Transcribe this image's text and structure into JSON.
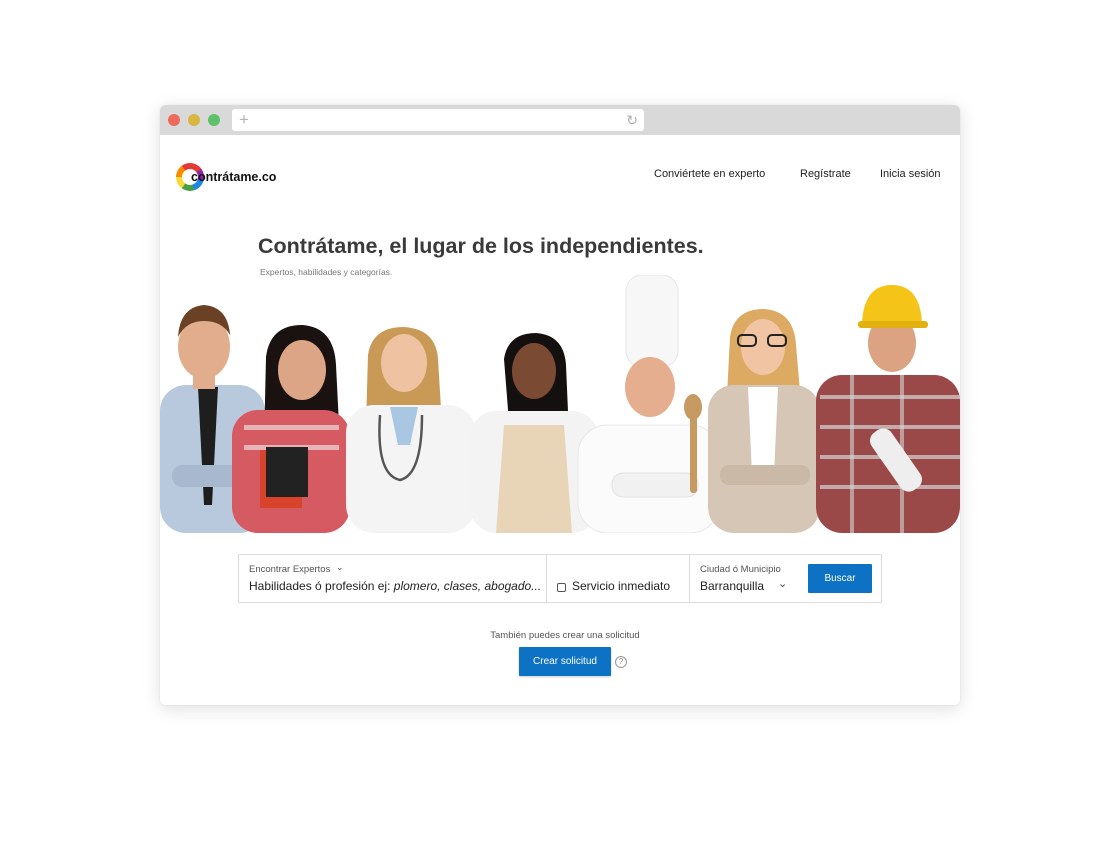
{
  "browser": {
    "new_tab_icon": "plus-icon",
    "reload_icon": "reload-icon",
    "new_tab_glyph": "+",
    "reload_glyph": "↻"
  },
  "header": {
    "logo_text": "contrátame.co",
    "nav": [
      "Conviértete en experto",
      "Regístrate",
      "Inicia sesión"
    ]
  },
  "hero": {
    "title": "Contrátame, el lugar de los independientes.",
    "subtitle": "Expertos, habilidades y categorías."
  },
  "search": {
    "experts_label": "Encontrar Expertos",
    "skills_prefix": "Habilidades ó profesión ej: ",
    "skills_example": "plomero, clases, abogado...",
    "immediate_label": "Servicio inmediato",
    "city_label": "Ciudad ó Municipio",
    "city_value": "Barranquilla",
    "search_button": "Buscar",
    "chevron_glyph": "⌄"
  },
  "request": {
    "text": "También puedes crear una solicitud",
    "button": "Crear solicitud",
    "help_glyph": "?"
  },
  "colors": {
    "accent": "#0d72c4",
    "photo_background": "#ffffff"
  }
}
